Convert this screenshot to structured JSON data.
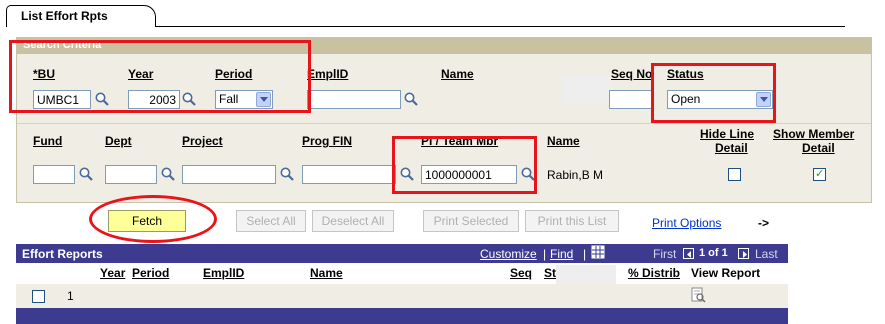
{
  "tab": {
    "label": "List Effort Rpts"
  },
  "search_criteria": {
    "header": "Search Criteria",
    "row1": {
      "bu_label": "*BU",
      "bu_value": "UMBC1",
      "year_label": "Year",
      "year_value": "2003",
      "period_label": "Period",
      "period_value": "Fall",
      "emplid_label": "EmplID",
      "emplid_value": "",
      "name_label": "Name",
      "seqno_label": "Seq No",
      "seqno_value": "",
      "status_label": "Status",
      "status_value": "Open"
    },
    "row2": {
      "fund_label": "Fund",
      "fund_value": "",
      "dept_label": "Dept",
      "dept_value": "",
      "project_label": "Project",
      "project_value": "",
      "progfin_label": "Prog FIN",
      "progfin_value": "",
      "pi_label": "PI / Team Mbr",
      "pi_value": "1000000001",
      "name_label": "Name",
      "name_value": "Rabin,B M",
      "hide_line_label_1": "Hide Line",
      "hide_line_label_2": "Detail",
      "hide_line_checked": false,
      "show_member_label_1": "Show Member",
      "show_member_label_2": "Detail",
      "show_member_checked": true
    }
  },
  "buttons": {
    "fetch": "Fetch",
    "select_all": "Select All",
    "deselect_all": "Deselect All",
    "print_selected": "Print Selected",
    "print_list": "Print this List",
    "print_options": "Print Options",
    "arrow": "->"
  },
  "grid": {
    "title": "Effort Reports",
    "customize": "Customize",
    "separator": "|",
    "find": "Find",
    "first": "First",
    "range": "1 of 1",
    "last": "Last",
    "columns": {
      "year": "Year",
      "period": "Period",
      "emplid": "EmplID",
      "name": "Name",
      "seq": "Seq",
      "status": "St",
      "distrib": "% Distrib",
      "view_report": "View Report"
    },
    "rows": [
      {
        "row_number": "1",
        "checked": false
      }
    ]
  },
  "colors": {
    "header_bg": "#c9c2a0",
    "panel_bg": "#f0eee4",
    "grid_header_bg": "#3d3b8f",
    "annotation_red": "#e8141b",
    "fetch_bg": "#ffff99",
    "link_blue": "#0033cc"
  }
}
